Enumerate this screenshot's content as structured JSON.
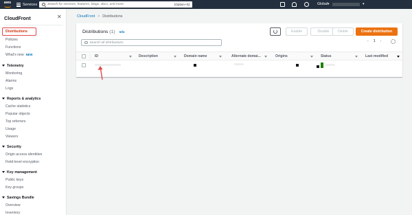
{
  "topbar": {
    "logo_text": "aws",
    "services_label": "Services",
    "search_placeholder": "Search for services, features, blogs, docs, and more",
    "search_shortcut": "[Option+S]",
    "region_label": "Global"
  },
  "sidebar": {
    "title": "CloudFront",
    "close_icon": "close-icon",
    "items": [
      {
        "label": "Distributions",
        "active": true
      },
      {
        "label": "Policies"
      },
      {
        "label": "Functions"
      },
      {
        "label": "What's new",
        "badge": "NEW"
      }
    ],
    "sections": [
      {
        "title": "Telemetry",
        "items": [
          "Monitoring",
          "Alarms",
          "Logs"
        ]
      },
      {
        "title": "Reports & analytics",
        "items": [
          "Cache statistics",
          "Popular objects",
          "Top referrers",
          "Usage",
          "Viewers"
        ]
      },
      {
        "title": "Security",
        "items": [
          "Origin access identities",
          "Field-level encryption"
        ]
      },
      {
        "title": "Key management",
        "items": [
          "Public keys",
          "Key groups"
        ]
      },
      {
        "title": "Savings Bundle",
        "items": [
          "Overview",
          "Inventory"
        ]
      }
    ]
  },
  "breadcrumb": {
    "root": "CloudFront",
    "current": "Distributions"
  },
  "panel": {
    "title": "Distributions",
    "count": "(1)",
    "info": "Info",
    "buttons": {
      "enable": "Enable",
      "disable": "Disable",
      "delete": "Delete",
      "create": "Create distribution"
    },
    "filter_placeholder": "Search all distributions",
    "page_number": "1"
  },
  "table": {
    "columns": [
      "ID",
      "Description",
      "Domain name",
      "Alternate domai...",
      "Origins",
      "Status",
      "Last modified"
    ],
    "rows": [
      {
        "id": "",
        "description": "",
        "domain_name": "",
        "alternate_domain": "",
        "origins": "",
        "status": "",
        "last_modified": ""
      }
    ]
  },
  "colors": {
    "nav_bg": "#232f3e",
    "accent_orange": "#ec7211",
    "link_blue": "#0073bb",
    "active_red": "#d13212",
    "status_green": "#1d8102",
    "annotation_red": "#e0484d"
  }
}
